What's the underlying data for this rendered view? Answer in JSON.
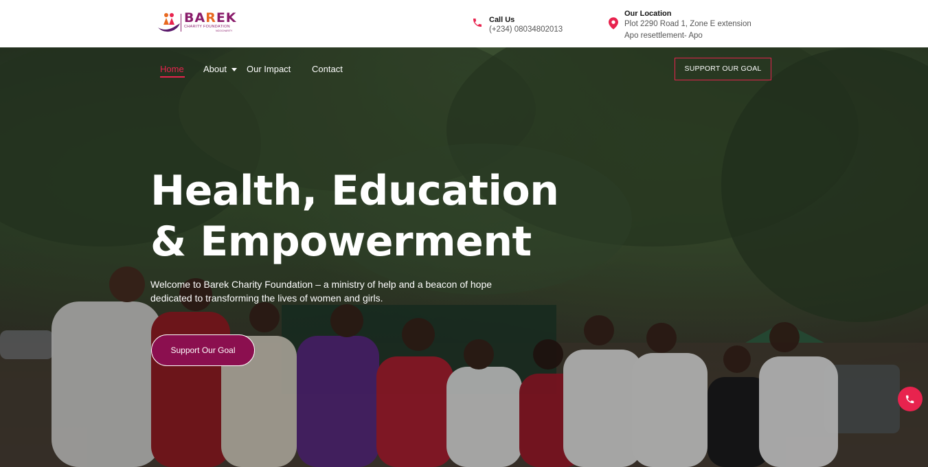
{
  "brand": {
    "name_part1": "BA",
    "name_part2": "R",
    "name_part3": "EK",
    "tagline": "CHARITY FOUNDATION",
    "small_text": "NGO/CHARITY",
    "primary_color": "#8a1c6b",
    "accent_color": "#e8234e"
  },
  "contact": {
    "call": {
      "title": "Call Us",
      "value": "(+234) 08034802013",
      "icon": "phone-icon"
    },
    "location": {
      "title": "Our Location",
      "line1": "Plot 2290 Road 1, Zone E extension",
      "line2": "Apo resettlement- Apo",
      "icon": "map-pin-icon"
    }
  },
  "nav": {
    "items": [
      {
        "label": "Home",
        "active": true
      },
      {
        "label": "About",
        "has_dropdown": true
      },
      {
        "label": "Our Impact"
      },
      {
        "label": "Contact"
      }
    ],
    "cta_label": "SUPPORT OUR GOAL"
  },
  "hero": {
    "headline_line1": "Health, Education",
    "headline_line2": "& Empowerment",
    "subtext": "Welcome to Barek Charity Foundation – a ministry of help and a beacon of hope dedicated to transforming the lives of women and girls.",
    "button_label": "Support Our Goal",
    "button_color": "#8b0f4f"
  },
  "floating": {
    "icon": "phone-icon",
    "color": "#e8234e"
  }
}
